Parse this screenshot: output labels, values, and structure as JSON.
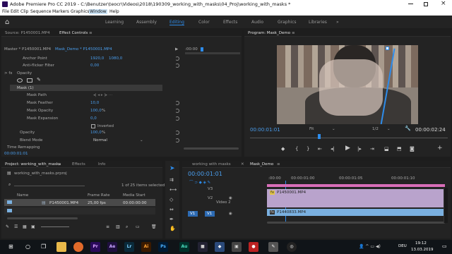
{
  "titlebar": {
    "title": "Adobe Premiere Pro CC 2019 - C:\\Benutzer\\teocr\\Videos\\2018\\190309_working_with_masks\\04_Proj\\working_with_masks *"
  },
  "menu": [
    "File",
    "Edit",
    "Clip",
    "Sequence",
    "Markers",
    "Graphics",
    "Window",
    "Help"
  ],
  "workspaces": [
    "Learning",
    "Assembly",
    "Editing",
    "Color",
    "Effects",
    "Audio",
    "Graphics",
    "Libraries"
  ],
  "active_workspace": "Editing",
  "source_panel": {
    "tab_source": "Source: P1450001.MP4",
    "tab_effect_controls": "Effect Controls"
  },
  "effect_controls": {
    "clip_path": "Master * P1450001.MP4",
    "seq_path": "Mask_Demo * P1450001.MP4",
    "ruler_time": ":00:00",
    "rows": {
      "anchor_label": "Anchor Point",
      "anchor_x": "1920,0",
      "anchor_y": "1080,0",
      "flicker_label": "Anti-flicker Filter",
      "flicker_val": "0,00",
      "opacity_section": "Opacity",
      "mask_label": "Mask (1)",
      "mask_path": "Mask Path",
      "mask_feather": "Mask Feather",
      "mask_feather_val": "10,0",
      "mask_opacity": "Mask Opacity",
      "mask_opacity_val": "100,0",
      "mask_opacity_unit": "%",
      "mask_expansion": "Mask Expansion",
      "mask_expansion_val": "0,0",
      "inverted": "Inverted",
      "opacity_label": "Opacity",
      "opacity_val": "100,0",
      "opacity_unit": "%",
      "blend_label": "Blend Mode",
      "blend_val": "Normal",
      "time_remap": "Time Remapping"
    },
    "timecode": "00:00:01:01"
  },
  "program": {
    "tab": "Program: Mask_Demo",
    "timecode": "00:00:01:01",
    "fit": "Fit",
    "quality": "1/2",
    "duration": "00:00:02:24"
  },
  "project": {
    "tab_project": "Project: working_with_masks",
    "tab_effects": "Effects",
    "tab_info": "Info",
    "file": "working_with_masks.prproj",
    "selection": "1 of 25 items selected",
    "columns": [
      "Name",
      "Frame Rate",
      "Media Start"
    ],
    "row": {
      "name": "P1450001.MP4",
      "rate": "25,00 fps",
      "start": "00:00:00:00"
    }
  },
  "timeline": {
    "tab_working": "working with masks",
    "tab_mask": "Mask_Demo",
    "timecode": "00:00:01:01",
    "ruler": [
      ":00:00",
      "00:00:01:00",
      "00:00:01:05",
      "00:00:01:10"
    ],
    "tracks": {
      "v3": "V3",
      "v2": "V2",
      "v1": "V1",
      "v1_src": "V1",
      "video2": "Video 2"
    },
    "clip_v2": "P1450001.MP4",
    "clip_v1": "P1440833.MP4"
  },
  "taskbar": {
    "lang": "DEU",
    "time": "19:12",
    "date": "13.03.2019"
  },
  "colors": {
    "accent": "#2d8ceb",
    "clip_v2": "#b9a3cc",
    "clip_v1": "#7ab0e0",
    "mask_label_bg": "#3a3a3a"
  }
}
